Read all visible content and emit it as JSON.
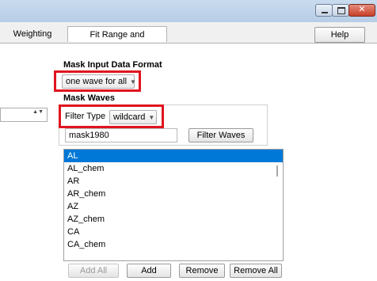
{
  "window": {
    "controls": {
      "minimize": "minimize",
      "maximize": "maximize",
      "close": "✕"
    }
  },
  "tabs": [
    {
      "label": "Weighting",
      "selected": false
    },
    {
      "label": "Fit Range and Masking",
      "selected": true
    }
  ],
  "help_label": "Help",
  "mask_input_format": {
    "label": "Mask Input Data Format",
    "value": "one wave for all",
    "arrow": "▼"
  },
  "mask_waves": {
    "label": "Mask Waves",
    "filter_type_label": "Filter Type",
    "filter_type_value": "wildcard",
    "filter_text": "mask1980",
    "filter_button": "Filter Waves",
    "items": [
      "AL",
      "AL_chem",
      "AR",
      "AR_chem",
      "AZ",
      "AZ_chem",
      "CA",
      "CA_chem"
    ],
    "selected_index": 0
  },
  "spinner_arrows": "▲▼",
  "buttons": {
    "add_all": "Add All",
    "add": "Add",
    "remove": "Remove",
    "remove_all": "Remove All"
  },
  "colors": {
    "highlight_box": "#e0141e",
    "selection": "#0078d7"
  }
}
